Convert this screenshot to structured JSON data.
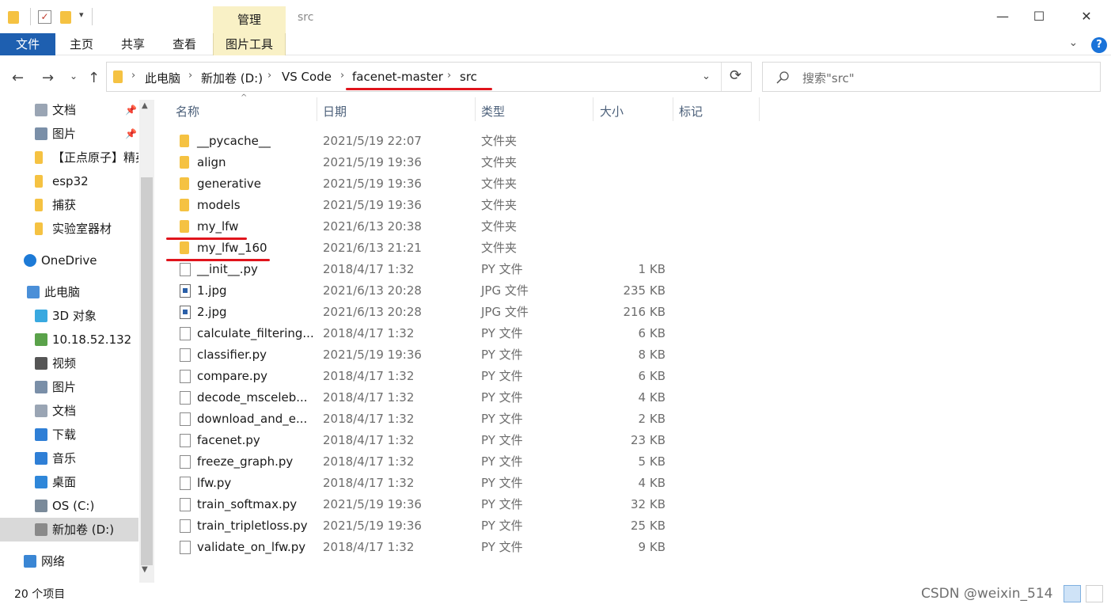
{
  "window": {
    "title": "src",
    "manage_tab": "管理",
    "minimize": "—",
    "maximize": "☐",
    "close": "✕"
  },
  "ribbon": {
    "file": "文件",
    "home": "主页",
    "share": "共享",
    "view": "查看",
    "picture_tools": "图片工具",
    "collapse": "⌄",
    "help": "?"
  },
  "nav": {
    "back": "←",
    "forward": "→",
    "recent": "⌄",
    "up": "↑",
    "refresh": "⟳"
  },
  "address": {
    "crumbs": [
      "此电脑",
      "新加卷 (D:)",
      "VS Code",
      "facenet-master",
      "src"
    ],
    "separator": "›",
    "dropdown": "⌄"
  },
  "search": {
    "placeholder": "搜索\"src\""
  },
  "sidebar": {
    "items": [
      {
        "label": "文档",
        "icon": "documents-icon",
        "pinned": true
      },
      {
        "label": "图片",
        "icon": "pictures-icon",
        "pinned": true
      },
      {
        "label": "【正点原子】精英",
        "icon": "folder-icon"
      },
      {
        "label": "esp32",
        "icon": "folder-icon"
      },
      {
        "label": "捕获",
        "icon": "folder-icon"
      },
      {
        "label": "实验室器材",
        "icon": "folder-icon"
      },
      {
        "label": "OneDrive",
        "icon": "onedrive-icon"
      },
      {
        "label": "此电脑",
        "icon": "this-pc-icon"
      },
      {
        "label": "3D 对象",
        "icon": "3d-objects-icon"
      },
      {
        "label": "10.18.52.132",
        "icon": "network-drive-icon"
      },
      {
        "label": "视频",
        "icon": "videos-icon"
      },
      {
        "label": "图片",
        "icon": "pictures-icon"
      },
      {
        "label": "文档",
        "icon": "documents-icon"
      },
      {
        "label": "下载",
        "icon": "downloads-icon"
      },
      {
        "label": "音乐",
        "icon": "music-icon"
      },
      {
        "label": "桌面",
        "icon": "desktop-icon"
      },
      {
        "label": "OS (C:)",
        "icon": "drive-c-icon"
      },
      {
        "label": "新加卷 (D:)",
        "icon": "drive-d-icon",
        "selected": true
      },
      {
        "label": "网络",
        "icon": "network-icon"
      }
    ],
    "pin_glyph": "📌"
  },
  "columns": {
    "name": "名称",
    "date": "日期",
    "type": "类型",
    "size": "大小",
    "tags": "标记"
  },
  "files": [
    {
      "name": "__pycache__",
      "date": "2021/5/19 22:07",
      "type": "文件夹",
      "size": "",
      "kind": "folder"
    },
    {
      "name": "align",
      "date": "2021/5/19 19:36",
      "type": "文件夹",
      "size": "",
      "kind": "folder"
    },
    {
      "name": "generative",
      "date": "2021/5/19 19:36",
      "type": "文件夹",
      "size": "",
      "kind": "folder"
    },
    {
      "name": "models",
      "date": "2021/5/19 19:36",
      "type": "文件夹",
      "size": "",
      "kind": "folder"
    },
    {
      "name": "my_lfw",
      "date": "2021/6/13 20:38",
      "type": "文件夹",
      "size": "",
      "kind": "folder"
    },
    {
      "name": "my_lfw_160",
      "date": "2021/6/13 21:21",
      "type": "文件夹",
      "size": "",
      "kind": "folder"
    },
    {
      "name": "__init__.py",
      "date": "2018/4/17 1:32",
      "type": "PY 文件",
      "size": "1 KB",
      "kind": "doc"
    },
    {
      "name": "1.jpg",
      "date": "2021/6/13 20:28",
      "type": "JPG 文件",
      "size": "235 KB",
      "kind": "jpg"
    },
    {
      "name": "2.jpg",
      "date": "2021/6/13 20:28",
      "type": "JPG 文件",
      "size": "216 KB",
      "kind": "jpg"
    },
    {
      "name": "calculate_filtering...",
      "date": "2018/4/17 1:32",
      "type": "PY 文件",
      "size": "6 KB",
      "kind": "doc"
    },
    {
      "name": "classifier.py",
      "date": "2021/5/19 19:36",
      "type": "PY 文件",
      "size": "8 KB",
      "kind": "doc"
    },
    {
      "name": "compare.py",
      "date": "2018/4/17 1:32",
      "type": "PY 文件",
      "size": "6 KB",
      "kind": "doc"
    },
    {
      "name": "decode_msceleb...",
      "date": "2018/4/17 1:32",
      "type": "PY 文件",
      "size": "4 KB",
      "kind": "doc"
    },
    {
      "name": "download_and_e...",
      "date": "2018/4/17 1:32",
      "type": "PY 文件",
      "size": "2 KB",
      "kind": "doc"
    },
    {
      "name": "facenet.py",
      "date": "2018/4/17 1:32",
      "type": "PY 文件",
      "size": "23 KB",
      "kind": "doc"
    },
    {
      "name": "freeze_graph.py",
      "date": "2018/4/17 1:32",
      "type": "PY 文件",
      "size": "5 KB",
      "kind": "doc"
    },
    {
      "name": "lfw.py",
      "date": "2018/4/17 1:32",
      "type": "PY 文件",
      "size": "4 KB",
      "kind": "doc"
    },
    {
      "name": "train_softmax.py",
      "date": "2021/5/19 19:36",
      "type": "PY 文件",
      "size": "32 KB",
      "kind": "doc"
    },
    {
      "name": "train_tripletloss.py",
      "date": "2021/5/19 19:36",
      "type": "PY 文件",
      "size": "25 KB",
      "kind": "doc"
    },
    {
      "name": "validate_on_lfw.py",
      "date": "2018/4/17 1:32",
      "type": "PY 文件",
      "size": "9 KB",
      "kind": "doc"
    }
  ],
  "status": {
    "count": "20 个项目"
  },
  "watermark": "CSDN @weixin_514",
  "colors": {
    "file_tab": "#1e5fb0",
    "picture_tools_tab": "#f9f1c6",
    "folder": "#f5c242",
    "annotation_red": "#e0141c",
    "sidebar_selected": "#d9d9d9"
  }
}
